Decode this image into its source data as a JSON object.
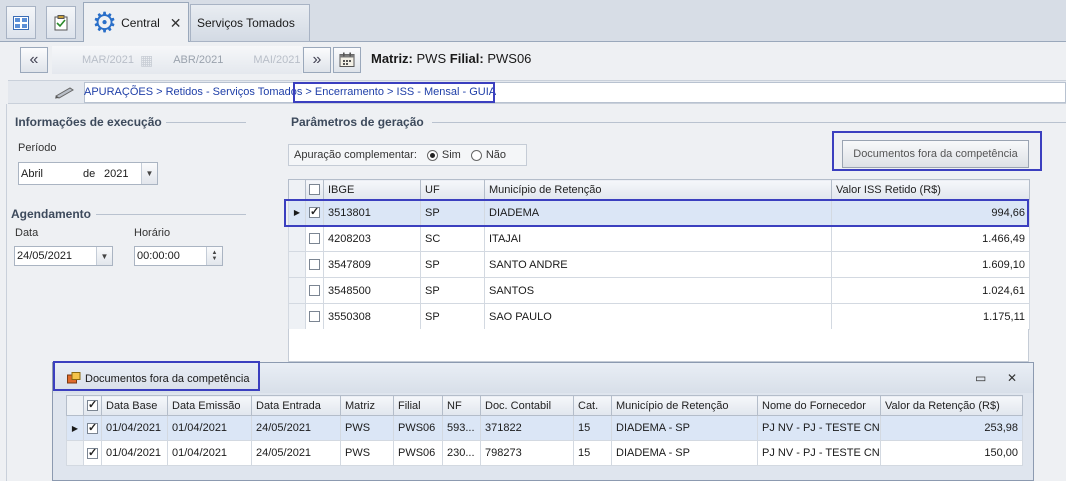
{
  "tabs": {
    "central_label": "Central",
    "close_glyph": "✕",
    "servicos_label": "Serviços Tomados"
  },
  "period_nav": {
    "prev_glyph": "«",
    "next_glyph": "»",
    "ghost_prev_month": "MAR/2021",
    "ghost_current_month": "ABR/2021",
    "ghost_next_month": "MAI/2021",
    "matriz_label": "Matriz:",
    "matriz_value": "PWS",
    "filial_label": "Filial:",
    "filial_value": "PWS06"
  },
  "breadcrumb": {
    "text": "APURAÇÕES > Retidos - Serviços Tomados > Encerramento > ISS - Mensal - GUIA"
  },
  "execucao": {
    "header": "Informações de execução",
    "periodo_label": "Período",
    "mes": "Abril",
    "de": "de",
    "ano": "2021"
  },
  "agendamento": {
    "header": "Agendamento",
    "data_label": "Data",
    "data_value": "24/05/2021",
    "horario_label": "Horário",
    "horario_value": "00:00:00"
  },
  "parametros": {
    "header": "Parâmetros de geração",
    "apuracao_label": "Apuração complementar:",
    "opt_sim": "Sim",
    "opt_nao": "Não",
    "selected": "Sim",
    "docs_button": "Documentos fora da competência"
  },
  "main_grid": {
    "columns": [
      "IBGE",
      "UF",
      "Município de Retenção",
      "Valor ISS Retido (R$)"
    ],
    "rows": [
      {
        "ibge": "3513801",
        "uf": "SP",
        "municipio": "DIADEMA",
        "valor": "994,66",
        "checked": true,
        "selected": true
      },
      {
        "ibge": "4208203",
        "uf": "SC",
        "municipio": "ITAJAI",
        "valor": "1.466,49",
        "checked": false,
        "selected": false
      },
      {
        "ibge": "3547809",
        "uf": "SP",
        "municipio": "SANTO ANDRE",
        "valor": "1.609,10",
        "checked": false,
        "selected": false
      },
      {
        "ibge": "3548500",
        "uf": "SP",
        "municipio": "SANTOS",
        "valor": "1.024,61",
        "checked": false,
        "selected": false
      },
      {
        "ibge": "3550308",
        "uf": "SP",
        "municipio": "SAO PAULO",
        "valor": "1.175,11",
        "checked": false,
        "selected": false
      }
    ]
  },
  "popup": {
    "title": "Documentos fora da competência",
    "minimize_glyph": "▭",
    "close_glyph": "✕",
    "columns": [
      "Data Base",
      "Data Emissão",
      "Data Entrada",
      "Matriz",
      "Filial",
      "NF",
      "Doc. Contabil",
      "Cat.",
      "Município de Retenção",
      "Nome do Fornecedor",
      "Valor da Retenção (R$)"
    ],
    "rows": [
      {
        "data_base": "01/04/2021",
        "data_emissao": "01/04/2021",
        "data_entrada": "24/05/2021",
        "matriz": "PWS",
        "filial": "PWS06",
        "nf": "593...",
        "doc": "371822",
        "cat": "15",
        "municipio": "DIADEMA - SP",
        "fornecedor": "PJ NV - PJ - TESTE CN...",
        "valor": "253,98",
        "checked": true,
        "selected": true
      },
      {
        "data_base": "01/04/2021",
        "data_emissao": "01/04/2021",
        "data_entrada": "24/05/2021",
        "matriz": "PWS",
        "filial": "PWS06",
        "nf": "230...",
        "doc": "798273",
        "cat": "15",
        "municipio": "DIADEMA - SP",
        "fornecedor": "PJ NV - PJ - TESTE CN...",
        "valor": "150,00",
        "checked": true,
        "selected": false
      }
    ]
  },
  "colors": {
    "highlight_box": "#3b3fbf",
    "selected_row": "#dbe6f6",
    "breadcrumb_link": "#1f3fa8"
  }
}
